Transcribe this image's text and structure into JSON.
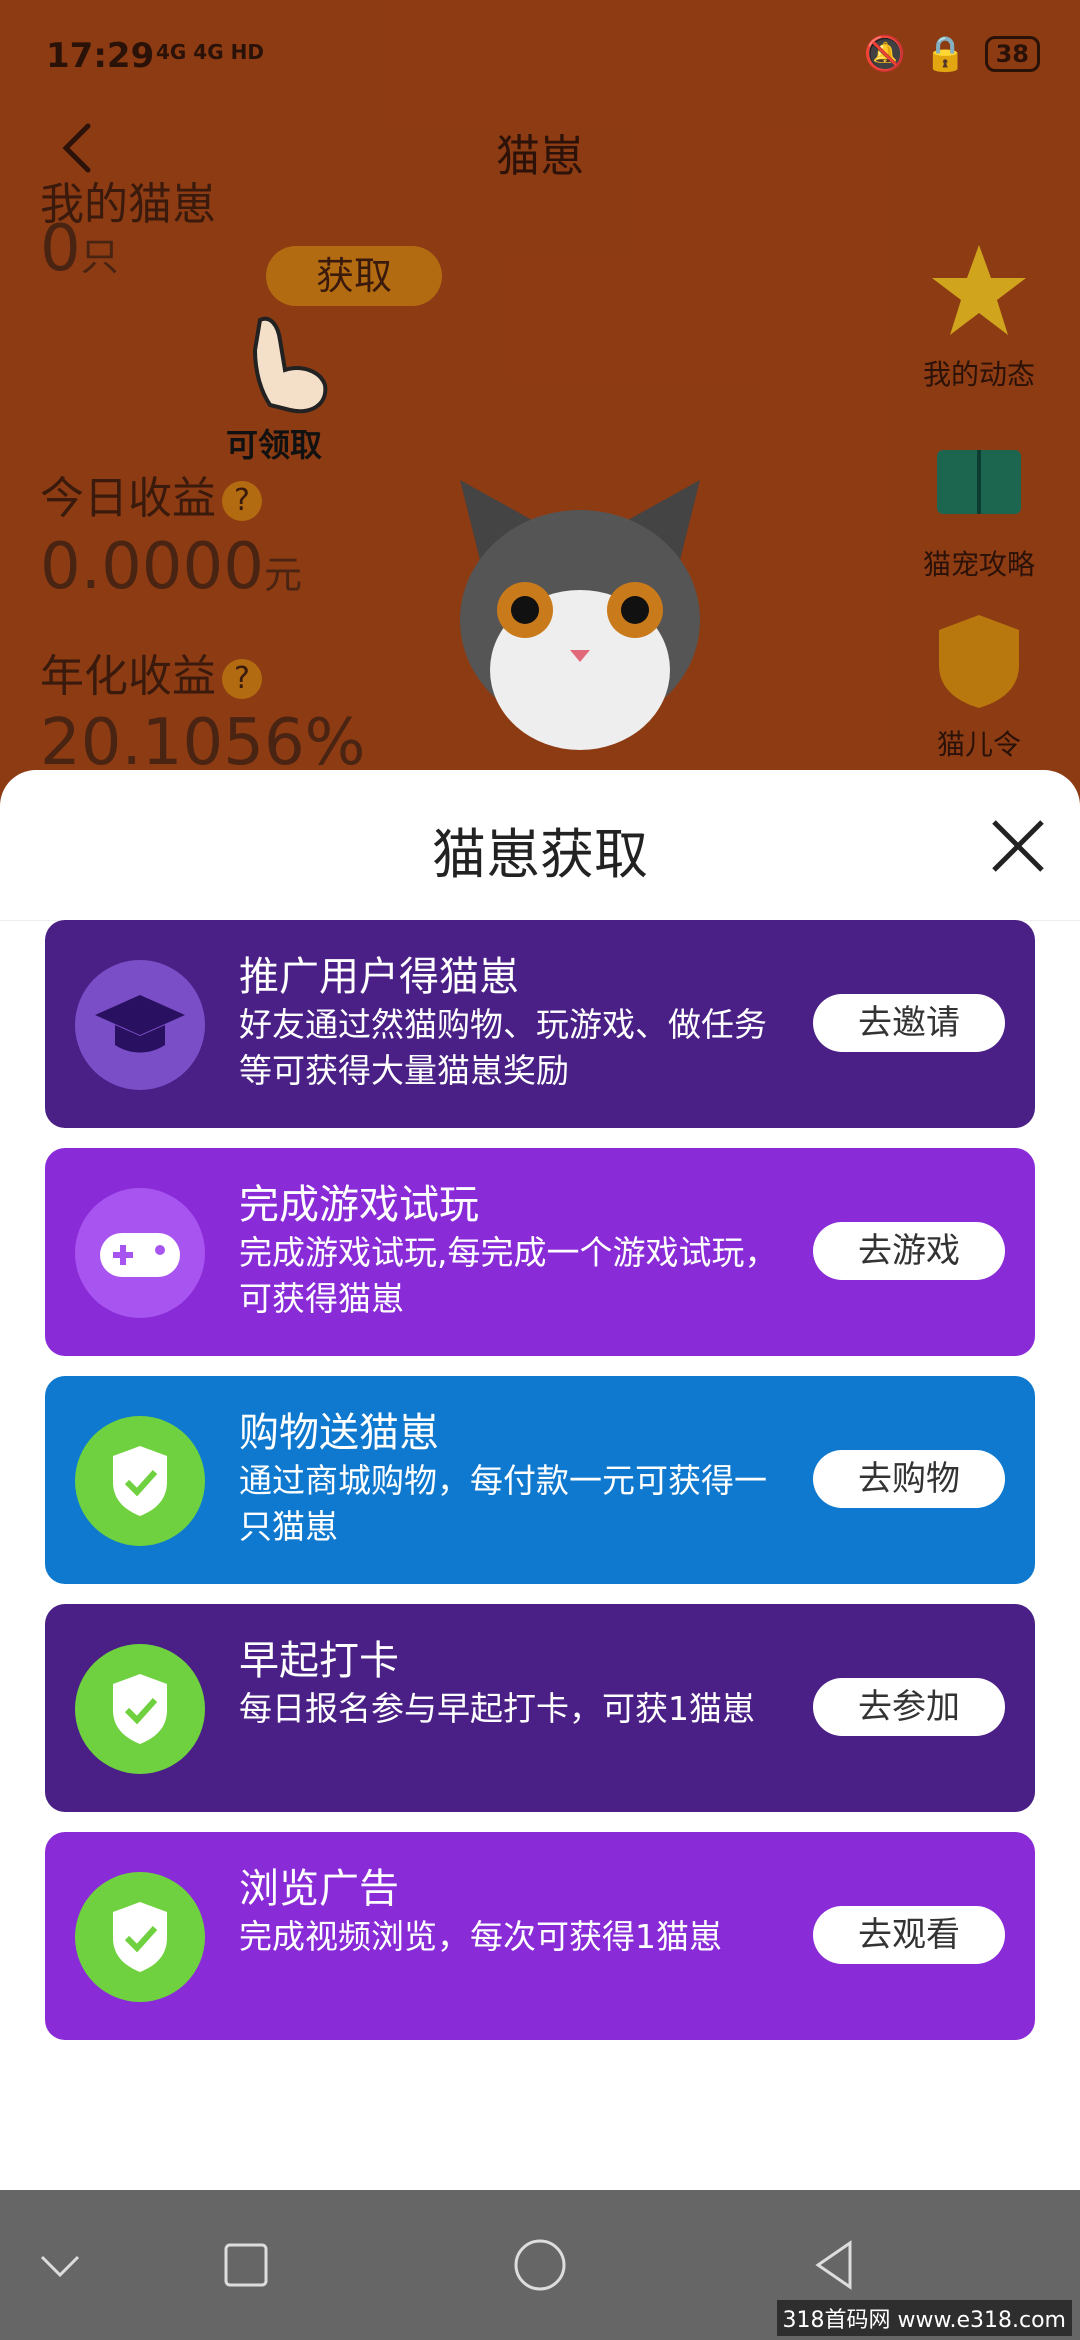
{
  "status": {
    "time": "17:29",
    "signal": "4G 4G HD",
    "battery": "38"
  },
  "header": {
    "title": "猫崽"
  },
  "stats": {
    "my_cats_label": "我的猫崽",
    "get_button": "获取",
    "my_cats_value": "0",
    "my_cats_unit": "只",
    "hint_text": "可领取",
    "today_label": "今日收益",
    "today_value": "0.0000",
    "today_unit": "元",
    "annual_label": "年化收益",
    "annual_value": "20.1056%",
    "qmark": "?"
  },
  "side": [
    {
      "label": "我的动态",
      "icon": "star-icon"
    },
    {
      "label": "猫宠攻略",
      "icon": "book-icon"
    },
    {
      "label": "猫儿令",
      "icon": "cat-badge-icon"
    }
  ],
  "sheet": {
    "title": "猫崽获取"
  },
  "cards": [
    {
      "title": "推广用户得猫崽",
      "desc": "好友通过然猫购物、玩游戏、做任务等可获得大量猫崽奖励",
      "button": "去邀请",
      "icon": "graduation-cap-icon",
      "color": "#4a2087",
      "circle": "#7a4ec7"
    },
    {
      "title": "完成游戏试玩",
      "desc": "完成游戏试玩,每完成一个游戏试玩，可获得猫崽",
      "button": "去游戏",
      "icon": "gamepad-icon",
      "color": "#8a2bd8",
      "circle": "#a854f0"
    },
    {
      "title": "购物送猫崽",
      "desc": "通过商城购物，每付款一元可获得一只猫崽",
      "button": "去购物",
      "icon": "shield-check-icon",
      "color": "#0f79cf",
      "circle": "#6fd13f"
    },
    {
      "title": "早起打卡",
      "desc": "每日报名参与早起打卡，可获1猫崽",
      "button": "去参加",
      "icon": "shield-check-icon",
      "color": "#4a2087",
      "circle": "#6fd13f"
    },
    {
      "title": "浏览广告",
      "desc": "完成视频浏览，每次可获得1猫崽",
      "button": "去观看",
      "icon": "shield-check-icon",
      "color": "#8a2bd8",
      "circle": "#6fd13f"
    }
  ],
  "watermark": "318首码网 www.e318.com"
}
